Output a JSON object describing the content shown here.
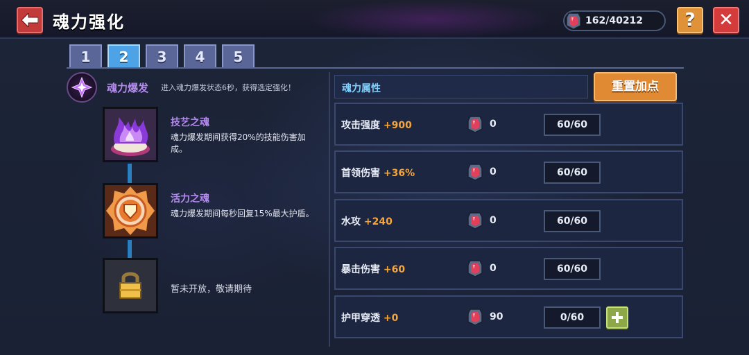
{
  "header": {
    "title": "魂力强化",
    "currency": "162/40212"
  },
  "tabs": [
    {
      "label": "1",
      "active": false
    },
    {
      "label": "2",
      "active": true
    },
    {
      "label": "3",
      "active": false
    },
    {
      "label": "4",
      "active": false
    },
    {
      "label": "5",
      "active": false
    }
  ],
  "burst": {
    "title": "魂力爆发",
    "desc": "进入魂力爆发状态6秒，获得选定强化！"
  },
  "skills": [
    {
      "name": "技艺之魂",
      "desc": "魂力爆发期间获得20%的技能伤害加成。",
      "icon": "purple-flame-icon"
    },
    {
      "name": "活力之魂",
      "desc": "魂力爆发期间每秒回复15%最大护盾。",
      "icon": "orange-shield-icon"
    },
    {
      "name": "",
      "desc": "暂未开放，敬请期待",
      "icon": "lock-icon"
    }
  ],
  "attributes": {
    "title": "魂力属性",
    "reset_label": "重置加点",
    "rows": [
      {
        "name": "攻击强度",
        "bonus": "+900",
        "cost": "0",
        "level": "60/60",
        "can_add": false
      },
      {
        "name": "首领伤害",
        "bonus": "+36%",
        "cost": "0",
        "level": "60/60",
        "can_add": false
      },
      {
        "name": "水攻",
        "bonus": "+240",
        "cost": "0",
        "level": "60/60",
        "can_add": false
      },
      {
        "name": "暴击伤害",
        "bonus": "+60",
        "cost": "0",
        "level": "60/60",
        "can_add": false
      },
      {
        "name": "护甲穿透",
        "bonus": "+0",
        "cost": "90",
        "level": "0/60",
        "can_add": true
      }
    ]
  },
  "colors": {
    "accent_purple": "#b58af0",
    "accent_orange": "#f5a53a",
    "accent_blue": "#7fd2ff",
    "active_tab": "#4da3e6"
  }
}
